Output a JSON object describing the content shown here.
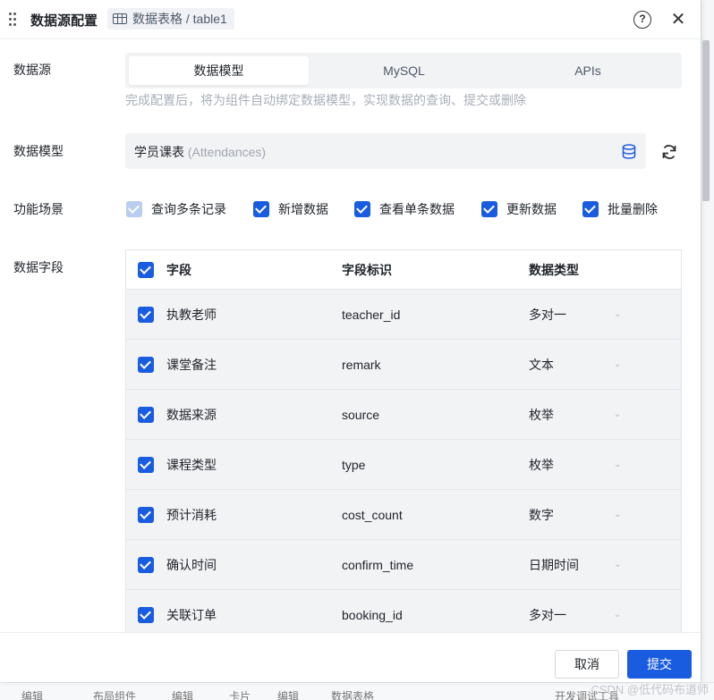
{
  "dialog": {
    "title": "数据源配置",
    "breadcrumb": "数据表格 / table1",
    "help_glyph": "?",
    "close_glyph": "✕"
  },
  "datasource": {
    "label": "数据源",
    "options": [
      "数据模型",
      "MySQL",
      "APIs"
    ],
    "selected": "数据模型",
    "hint": "完成配置后，将为组件自动绑定数据模型，实现数据的查询、提交或删除"
  },
  "model": {
    "label": "数据模型",
    "name": "学员课表",
    "name_en": "(Attendances)"
  },
  "scenes": {
    "label": "功能场景",
    "items": [
      {
        "label": "查询多条记录",
        "checked": true,
        "disabled": true
      },
      {
        "label": "新增数据",
        "checked": true,
        "disabled": false
      },
      {
        "label": "查看单条数据",
        "checked": true,
        "disabled": false
      },
      {
        "label": "更新数据",
        "checked": true,
        "disabled": false
      },
      {
        "label": "批量删除",
        "checked": true,
        "disabled": false
      }
    ]
  },
  "fields": {
    "label": "数据字段",
    "headers": {
      "field": "字段",
      "id": "字段标识",
      "type": "数据类型"
    },
    "rows": [
      {
        "name": "执教老师",
        "id": "teacher_id",
        "type": "多对一",
        "checked": true
      },
      {
        "name": "课堂备注",
        "id": "remark",
        "type": "文本",
        "checked": true
      },
      {
        "name": "数据来源",
        "id": "source",
        "type": "枚举",
        "checked": true
      },
      {
        "name": "课程类型",
        "id": "type",
        "type": "枚举",
        "checked": true
      },
      {
        "name": "预计消耗",
        "id": "cost_count",
        "type": "数字",
        "checked": true
      },
      {
        "name": "确认时间",
        "id": "confirm_time",
        "type": "日期时间",
        "checked": true
      },
      {
        "name": "关联订单",
        "id": "booking_id",
        "type": "多对一",
        "checked": true
      }
    ]
  },
  "footer": {
    "cancel": "取消",
    "submit": "提交"
  },
  "background": {
    "crumbs": [
      "编辑",
      "布局组件",
      "编辑",
      "卡片",
      "编辑",
      "数据表格"
    ],
    "right_text": "开发调试工具",
    "watermark": "CSDN @低代码布道师"
  },
  "colors": {
    "primary": "#1a5ce0"
  }
}
